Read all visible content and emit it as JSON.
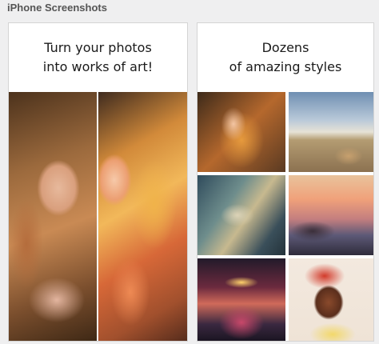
{
  "section": {
    "title": "iPhone Screenshots"
  },
  "screenshots": [
    {
      "caption_line1": "Turn your photos",
      "caption_line2": "into works of art!"
    },
    {
      "caption_line1": "Dozens",
      "caption_line2": "of amazing styles"
    }
  ]
}
